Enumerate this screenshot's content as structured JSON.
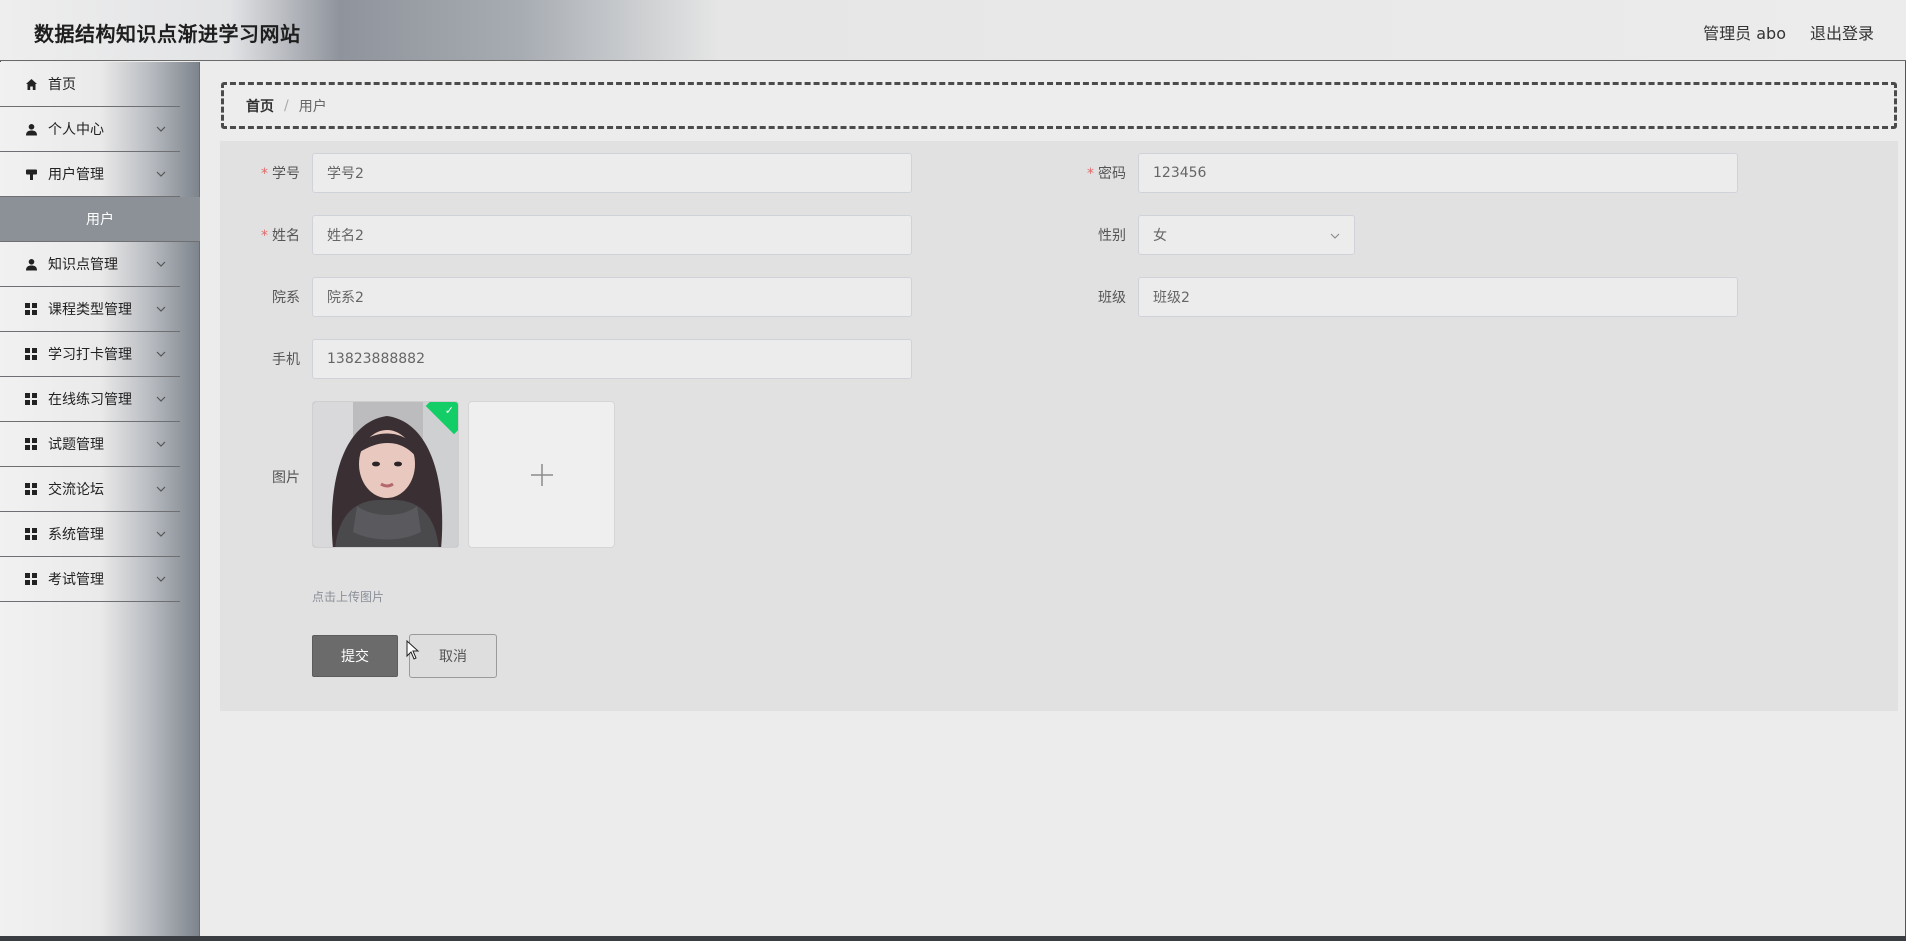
{
  "header": {
    "title": "数据结构知识点渐进学习网站",
    "user_label": "管理员 abo",
    "logout_label": "退出登录"
  },
  "sidebar": {
    "items": [
      {
        "label": "首页",
        "icon": "home-icon"
      },
      {
        "label": "个人中心",
        "icon": "person-icon"
      },
      {
        "label": "用户管理",
        "icon": "user-manage-icon",
        "expanded": true
      },
      {
        "label": "知识点管理",
        "icon": "person-icon"
      },
      {
        "label": "课程类型管理",
        "icon": "grid-icon"
      },
      {
        "label": "学习打卡管理",
        "icon": "grid-icon"
      },
      {
        "label": "在线练习管理",
        "icon": "grid-icon"
      },
      {
        "label": "试题管理",
        "icon": "grid-icon"
      },
      {
        "label": "交流论坛",
        "icon": "grid-icon"
      },
      {
        "label": "系统管理",
        "icon": "grid-icon"
      },
      {
        "label": "考试管理",
        "icon": "grid-icon"
      }
    ],
    "active_sub": "用户"
  },
  "breadcrumb": {
    "home": "首页",
    "separator": "/",
    "current": "用户"
  },
  "form": {
    "student_id": {
      "label": "学号",
      "value": "学号2",
      "required": true
    },
    "password": {
      "label": "密码",
      "value": "123456",
      "required": true
    },
    "name": {
      "label": "姓名",
      "value": "姓名2",
      "required": true
    },
    "gender": {
      "label": "性别",
      "value": "女"
    },
    "department": {
      "label": "院系",
      "value": "院系2"
    },
    "class": {
      "label": "班级",
      "value": "班级2"
    },
    "phone": {
      "label": "手机",
      "value": "13823888882"
    },
    "image": {
      "label": "图片",
      "tip": "点击上传图片"
    },
    "required_mark": "*",
    "submit_label": "提交",
    "cancel_label": "取消"
  },
  "colors": {
    "submit_bg": "#6b6b6b",
    "active_sub_bg": "#8c9197",
    "success_badge": "#13ce66",
    "required": "#e06a6a"
  }
}
